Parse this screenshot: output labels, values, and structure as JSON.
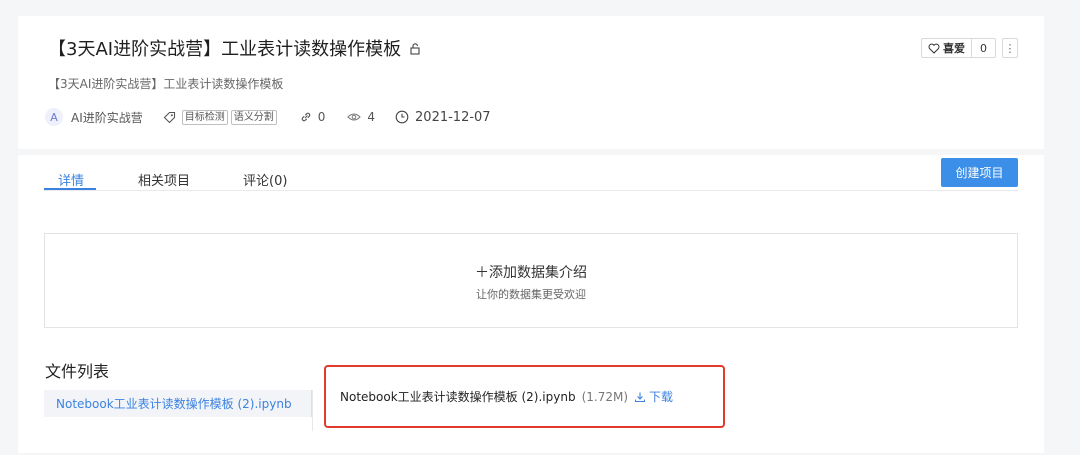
{
  "header": {
    "title": "【3天AI进阶实战营】工业表计读数操作模板",
    "subtitle": "【3天AI进阶实战营】工业表计读数操作模板",
    "lock_icon": "lock-icon",
    "avatar_letter": "A",
    "org_name": "AI进阶实战营",
    "tags": [
      "目标检测",
      "语义分割"
    ],
    "fork_count": "0",
    "view_count": "4",
    "date": "2021-12-07",
    "like_label": "喜爱",
    "like_count": "0",
    "more_label": "⋮"
  },
  "tabs": [
    {
      "label": "详情",
      "active": true
    },
    {
      "label": "相关项目",
      "active": false
    },
    {
      "label": "评论(0)",
      "active": false
    }
  ],
  "create_button": "创建项目",
  "intro": {
    "title": "＋添加数据集介绍",
    "subtitle": "让你的数据集更受欢迎"
  },
  "files": {
    "heading": "文件列表",
    "items": [
      {
        "name": "Notebook工业表计读数操作模板 (2).ipynb"
      }
    ],
    "preview": {
      "name": "Notebook工业表计读数操作模板 (2).ipynb",
      "size": "(1.72M)",
      "download_label": "下载"
    }
  },
  "colors": {
    "accent": "#3b82e0",
    "button": "#3b8fe8",
    "highlight_border": "#e23b2b"
  }
}
